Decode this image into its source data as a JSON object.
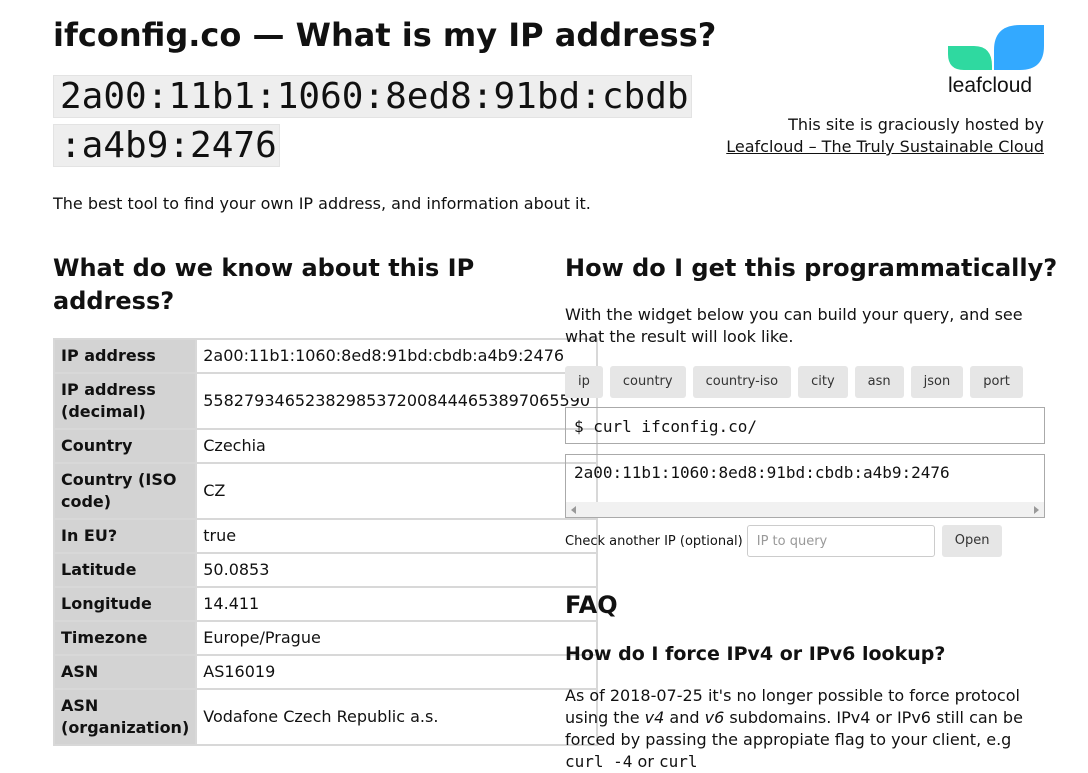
{
  "header": {
    "title": "ifconfig.co — What is my IP address?",
    "ip_line1": "2a00:11b1:1060:8ed8:91bd:cbdb",
    "ip_line2": ":a4b9:2476",
    "tagline": "The best tool to find your own IP address, and information about it."
  },
  "hosting": {
    "logo_text": "leafcloud",
    "text": "This site is graciously hosted by",
    "link": "Leafcloud – The Truly Sustainable Cloud"
  },
  "colors": {
    "logo_teal": "#2fd9a0",
    "logo_blue": "#33a9ff",
    "key_bg": "#d3d3d3",
    "button_bg": "#e6e6e6"
  },
  "left": {
    "heading_line1": "What do we know about this IP",
    "heading_line2": "address?",
    "rows": [
      {
        "key": "IP address",
        "value": "2a00:11b1:1060:8ed8:91bd:cbdb:a4b9:2476"
      },
      {
        "key": "IP address (decimal)",
        "value": "55827934652382985372008444653897065590"
      },
      {
        "key": "Country",
        "value": "Czechia"
      },
      {
        "key": "Country (ISO code)",
        "value": "CZ"
      },
      {
        "key": "In EU?",
        "value": "true"
      },
      {
        "key": "Latitude",
        "value": "50.0853"
      },
      {
        "key": "Longitude",
        "value": "14.411"
      },
      {
        "key": "Timezone",
        "value": "Europe/Prague"
      },
      {
        "key": "ASN",
        "value": "AS16019"
      },
      {
        "key": "ASN (organization)",
        "value": "Vodafone Czech Republic a.s."
      }
    ]
  },
  "right": {
    "heading": "How do I get this programmatically?",
    "intro": "With the widget below you can build your query, and see what the result will look like.",
    "buttons": [
      "ip",
      "country",
      "country-iso",
      "city",
      "asn",
      "json",
      "port"
    ],
    "command": "$ curl ifconfig.co/",
    "result": "2a00:11b1:1060:8ed8:91bd:cbdb:a4b9:2476",
    "check_label": "Check another IP (optional)",
    "check_placeholder": "IP to query",
    "open_label": "Open",
    "faq_heading": "FAQ",
    "faq_q1": "How do I force IPv4 or IPv6 lookup?",
    "faq_a1_part1": "As of 2018-07-25 it's no longer possible to force protocol using the ",
    "faq_a1_v4": "v4",
    "faq_a1_and": " and ",
    "faq_a1_v6": "v6",
    "faq_a1_part2": " subdomains. IPv4 or IPv6 still can be forced by passing the appropiate flag to your client, e.g ",
    "faq_a1_code1": "curl -4",
    "faq_a1_or": " or ",
    "faq_a1_code2": "curl"
  }
}
